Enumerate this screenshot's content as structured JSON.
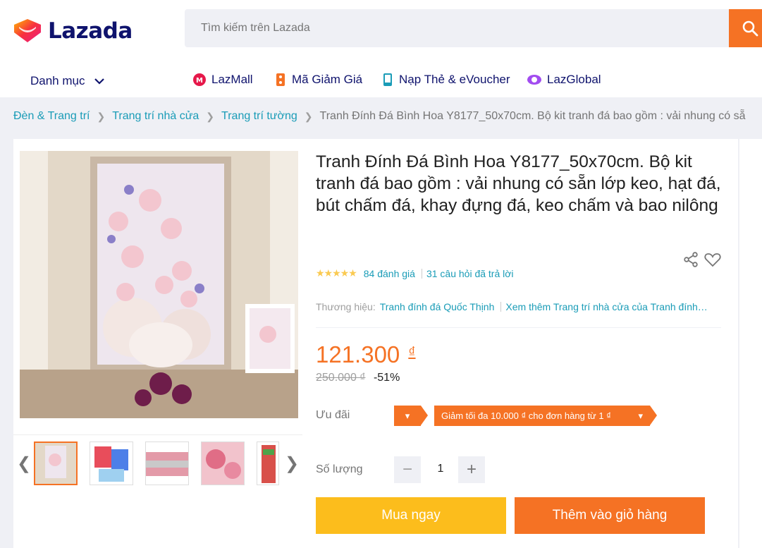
{
  "header": {
    "logo_text": "Lazada",
    "search_placeholder": "Tìm kiếm trên Lazada"
  },
  "nav": {
    "category_label": "Danh mục",
    "items": [
      {
        "label": "LazMall",
        "icon": "lazmall-icon"
      },
      {
        "label": "Mã Giảm Giá",
        "icon": "voucher-icon"
      },
      {
        "label": "Nạp Thẻ & eVoucher",
        "icon": "mobile-topup-icon"
      },
      {
        "label": "LazGlobal",
        "icon": "lazglobal-icon"
      }
    ]
  },
  "breadcrumb": [
    "Đèn & Trang trí",
    "Trang trí nhà cửa",
    "Trang trí tường",
    "Tranh Đính Đá Bình Hoa Y8177_50x70cm. Bộ kit tranh đá bao gồm : vải nhung có sẵ"
  ],
  "product": {
    "title": "Tranh Đính Đá Bình Hoa Y8177_50x70cm. Bộ kit tranh đá bao gồm : vải nhung có sẵn lớp keo, hạt đá, bút chấm đá, khay đựng đá, keo chấm và bao nilông",
    "rating_count": "84 đánh giá",
    "questions": "31 câu hỏi đã trả lời",
    "brand_label": "Thương hiệu:",
    "brand_name": "Tranh đính đá Quốc Thịnh",
    "more_link": "Xem thêm Trang trí nhà cửa của Tranh đính…",
    "price": "121.300",
    "currency": "₫",
    "old_price": "250.000 ₫",
    "discount": "-51%",
    "promo_label": "Ưu đãi",
    "voucher_text": "Giảm tối đa 10.000 ₫ cho đơn hàng từ 1 ₫",
    "qty_label": "Số lượng",
    "qty_value": "1",
    "buy_now": "Mua ngay",
    "add_to_cart": "Thêm vào giỏ hàng"
  },
  "colors": {
    "accent": "#f57224",
    "link": "#1a9cb7",
    "buy_now": "#fcbd1c",
    "brand_navy": "#0f136d"
  }
}
